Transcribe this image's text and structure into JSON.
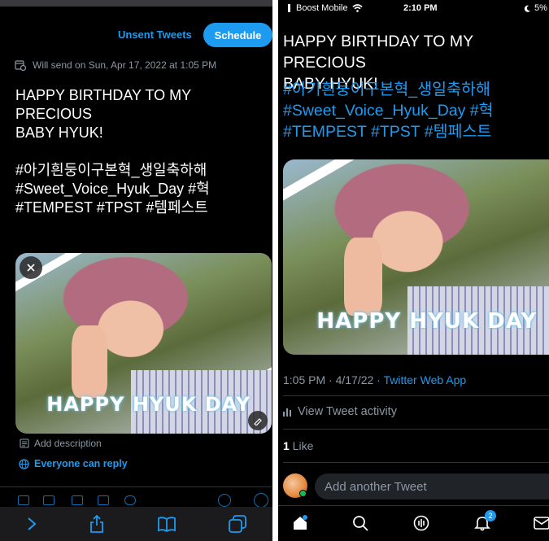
{
  "left": {
    "header": {
      "unsent_label": "Unsent Tweets",
      "schedule_label": "Schedule"
    },
    "send_notice": "Will send on Sun, Apr 17, 2022 at 1:05 PM",
    "tweet_lines": [
      "HAPPY BIRTHDAY TO MY PRECIOUS",
      "BABY HYUK!"
    ],
    "tweet_tags": [
      "#아기흰둥이구본혁_생일축하해",
      "#Sweet_Voice_Hyuk_Day #혁",
      "#TEMPEST #TPST #템페스트"
    ],
    "media_banner": "HAPPY HYUK DAY",
    "add_description": "Add description",
    "reply_setting": "Everyone can reply"
  },
  "right": {
    "status_bar": {
      "carrier": "Boost Mobile",
      "time": "2:10 PM",
      "battery": "5%"
    },
    "tweet_lines": [
      "HAPPY BIRTHDAY TO MY PRECIOUS",
      "BABY HYUK!"
    ],
    "tweet_tags": [
      "#아기흰둥이구본혁_생일축하해",
      "#Sweet_Voice_Hyuk_Day #혁",
      "#TEMPEST #TPST #템페스트"
    ],
    "media_banner": "HAPPY HYUK DAY",
    "meta": {
      "time": "1:05 PM · 4/17/22 · ",
      "app": "Twitter Web App"
    },
    "activity_label": "View Tweet activity",
    "likes": {
      "count": "1",
      "label": " Like"
    },
    "reply_placeholder": "Add another Tweet",
    "notifications_badge": "2"
  },
  "colors": {
    "accent": "#1d9bf0",
    "background": "#000000",
    "muted": "#8b98a5"
  }
}
